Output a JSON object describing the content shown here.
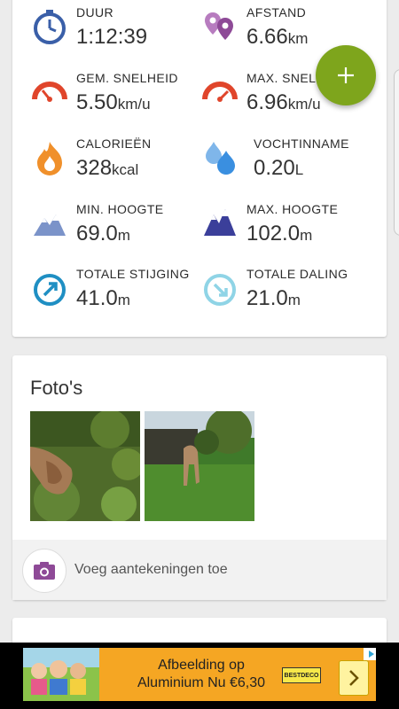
{
  "stats": [
    {
      "id": "duur",
      "label": "DUUR",
      "value": "1:12:39",
      "unit": "",
      "icon": "stopwatch-icon"
    },
    {
      "id": "afstand",
      "label": "AFSTAND",
      "value": "6.66",
      "unit": "km",
      "icon": "location-pins-icon"
    },
    {
      "id": "gem-snelheid",
      "label": "GEM. SNELHEID",
      "value": "5.50",
      "unit": "km/u",
      "icon": "speedometer-icon"
    },
    {
      "id": "max-snelheid",
      "label": "MAX. SNELHEID",
      "value": "6.96",
      "unit": "km/u",
      "icon": "speedometer-max-icon"
    },
    {
      "id": "calorieen",
      "label": "CALORIEËN",
      "value": "328",
      "unit": "kcal",
      "icon": "flame-icon"
    },
    {
      "id": "vochtinname",
      "label": "VOCHTINNAME",
      "value": "0.20",
      "unit": "L",
      "icon": "water-drops-icon"
    },
    {
      "id": "min-hoogte",
      "label": "MIN. HOOGTE",
      "value": "69.0",
      "unit": "m",
      "icon": "mountain-low-icon"
    },
    {
      "id": "max-hoogte",
      "label": "MAX. HOOGTE",
      "value": "102.0",
      "unit": "m",
      "icon": "mountain-high-icon"
    },
    {
      "id": "totale-stijging",
      "label": "TOTALE STIJGING",
      "value": "41.0",
      "unit": "m",
      "icon": "ascent-arrow-icon"
    },
    {
      "id": "totale-daling",
      "label": "TOTALE DALING",
      "value": "21.0",
      "unit": "m",
      "icon": "descent-arrow-icon"
    }
  ],
  "fab": {
    "icon": "plus-icon"
  },
  "photos": {
    "title": "Foto's"
  },
  "notes": {
    "label": "Voeg aantekeningen toe",
    "icon": "camera-icon"
  },
  "ad": {
    "line1": "Afbeelding op",
    "line2": "Aluminium Nu €6,30",
    "brand": "BESTDECO",
    "icon": "chevron-right-icon"
  },
  "colors": {
    "accent_green": "#7ea51c",
    "stopwatch_blue": "#3a5fa8",
    "pin_purple": "#8e4a97",
    "speed_red": "#e0452b",
    "flame_orange": "#f0902b",
    "water_blue": "#3a8fe0",
    "mountain_low": "#7b93c9",
    "mountain_high": "#3b3f9a",
    "ascent_blue": "#1f8fc3",
    "descent_teal": "#8fd4e6",
    "ad_orange": "#f5a623"
  }
}
